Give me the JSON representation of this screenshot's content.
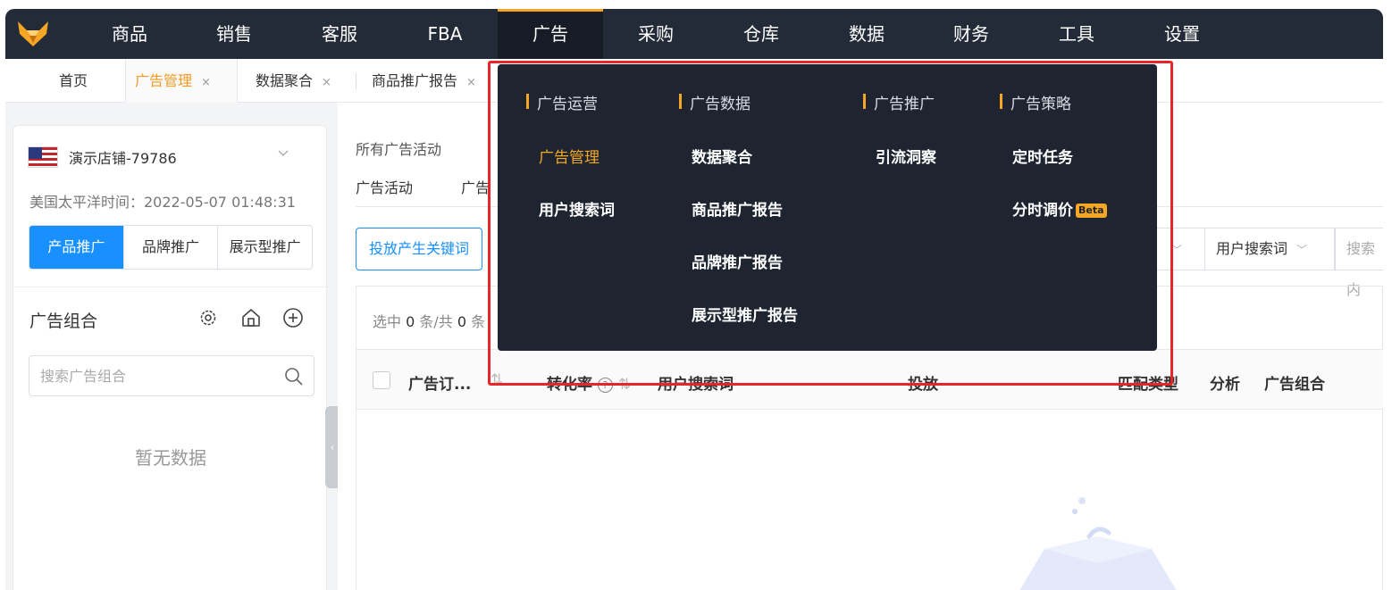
{
  "topnav": {
    "items": [
      "商品",
      "销售",
      "客服",
      "FBA",
      "广告",
      "采购",
      "仓库",
      "数据",
      "财务",
      "工具",
      "设置"
    ],
    "active": "广告",
    "accent": "#f5a623"
  },
  "tabs": [
    {
      "label": "首页",
      "closable": false
    },
    {
      "label": "广告管理",
      "closable": true,
      "active": true
    },
    {
      "label": "数据聚合",
      "closable": true
    },
    {
      "label": "商品推广报告",
      "closable": true
    }
  ],
  "tab_close": "×",
  "store": {
    "name": "演示店铺-79786",
    "timezone": "美国太平洋时间：2022-05-07 01:48:31"
  },
  "ad_types": [
    "产品推广",
    "品牌推广",
    "展示型推广"
  ],
  "ad_group": {
    "title": "广告组合",
    "search_placeholder": "搜索广告组合",
    "empty": "暂无数据"
  },
  "main": {
    "breadcrumb": "所有广告活动",
    "subtabs": [
      "广告活动",
      "广告"
    ],
    "action_button": "投放产生关键词",
    "filters": {
      "search_term": "用户搜索词",
      "search_placeholder": "搜索内"
    },
    "selection": {
      "prefix": "选中",
      "selected": "0",
      "mid": "条/共",
      "total": "0",
      "suffix": "条"
    },
    "columns": [
      "广告订...",
      "转化率",
      "用户搜索词",
      "投放",
      "匹配类型",
      "分析",
      "广告组合"
    ],
    "sort_glyph": "⇅",
    "help_glyph": "?"
  },
  "dropdown": {
    "columns": [
      {
        "title": "广告运营",
        "items": [
          "广告管理",
          "用户搜索词"
        ]
      },
      {
        "title": "广告数据",
        "items": [
          "数据聚合",
          "商品推广报告",
          "品牌推广报告",
          "展示型推广报告"
        ]
      },
      {
        "title": "广告推广",
        "items": [
          "引流洞察"
        ]
      },
      {
        "title": "广告策略",
        "items": [
          "定时任务",
          "分时调价"
        ]
      }
    ],
    "beta_badge": "Beta",
    "highlight_color": "#e8262a"
  }
}
